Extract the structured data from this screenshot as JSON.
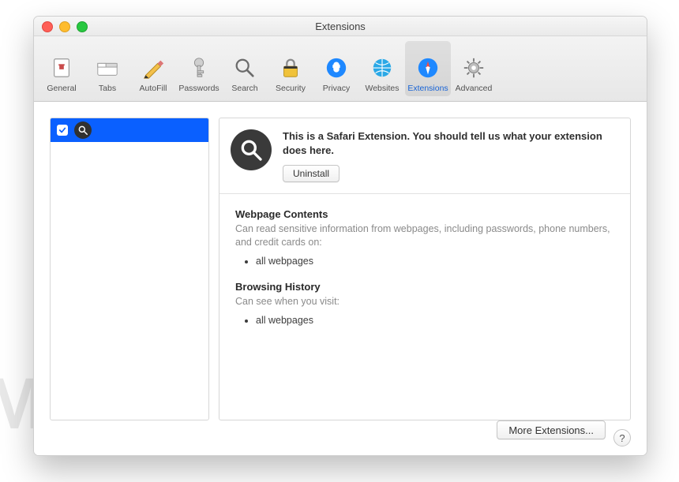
{
  "watermark": "MALWARETIPS",
  "window": {
    "title": "Extensions"
  },
  "toolbar": {
    "items": [
      {
        "label": "General",
        "icon": "general"
      },
      {
        "label": "Tabs",
        "icon": "tabs"
      },
      {
        "label": "AutoFill",
        "icon": "autofill"
      },
      {
        "label": "Passwords",
        "icon": "passwords"
      },
      {
        "label": "Search",
        "icon": "search"
      },
      {
        "label": "Security",
        "icon": "security"
      },
      {
        "label": "Privacy",
        "icon": "privacy"
      },
      {
        "label": "Websites",
        "icon": "websites"
      },
      {
        "label": "Extensions",
        "icon": "extensions"
      },
      {
        "label": "Advanced",
        "icon": "advanced"
      }
    ],
    "active_index": 8
  },
  "sidebar": {
    "items": [
      {
        "enabled": true,
        "icon": "magnifier"
      }
    ]
  },
  "detail": {
    "icon": "magnifier",
    "description": "This is a Safari Extension. You should tell us what your extension does here.",
    "uninstall_label": "Uninstall",
    "permissions": [
      {
        "title": "Webpage Contents",
        "subtitle": "Can read sensitive information from webpages, including passwords, phone numbers, and credit cards on:",
        "bullets": [
          "all webpages"
        ]
      },
      {
        "title": "Browsing History",
        "subtitle": "Can see when you visit:",
        "bullets": [
          "all webpages"
        ]
      }
    ]
  },
  "footer": {
    "more_label": "More Extensions...",
    "help_label": "?"
  }
}
